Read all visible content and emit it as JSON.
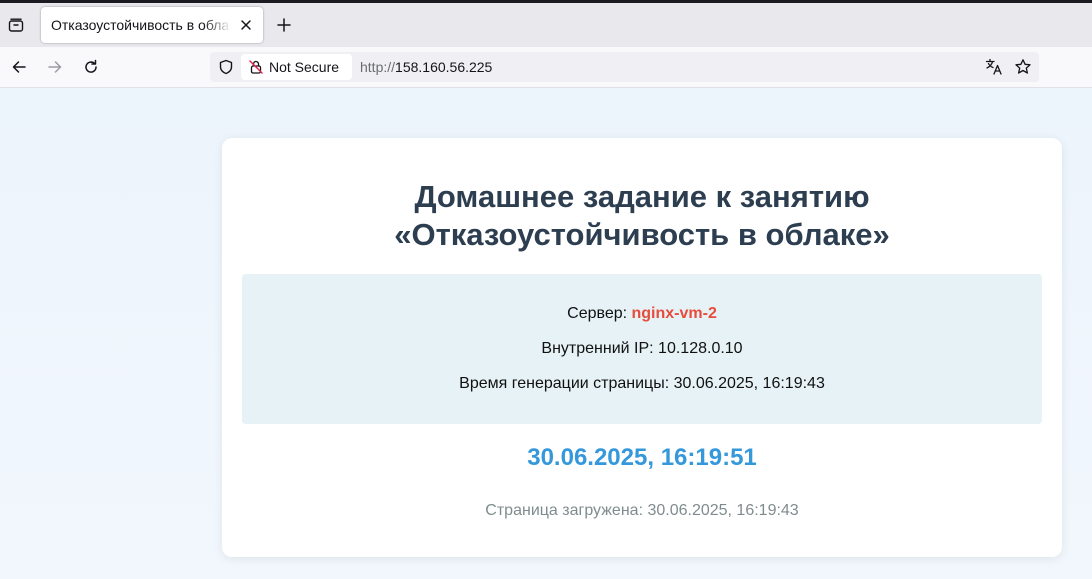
{
  "browser": {
    "tab": {
      "title": "Отказоустойчивость в облаке"
    },
    "security_label": "Not Secure",
    "url": {
      "scheme": "http://",
      "host": "158.160.56.225"
    }
  },
  "icons": {
    "tab_list": "tab-list-icon",
    "close": "close-icon",
    "new_tab": "plus-icon",
    "back": "arrow-left-icon",
    "forward": "arrow-right-icon",
    "reload": "reload-icon",
    "shield": "shield-icon",
    "insecure_lock": "lock-slash-icon",
    "translate": "translate-icon",
    "bookmark": "star-icon"
  },
  "page": {
    "title_line1": "Домашнее задание к занятию",
    "title_line2": "«Отказоустойчивость в облаке»",
    "server_label": "Сервер: ",
    "server_name": "nginx-vm-2",
    "ip_line": "Внутренний IP: 10.128.0.10",
    "generated_line": "Время генерации страницы: 30.06.2025, 16:19:43",
    "clock": "30.06.2025, 16:19:51",
    "loaded_line": "Страница загружена: 30.06.2025, 16:19:43"
  },
  "colors": {
    "title": "#2c3e50",
    "server_name": "#e74c3c",
    "clock": "#3498db",
    "muted": "#7f8c8d",
    "info_bg": "#e6f2f5"
  }
}
